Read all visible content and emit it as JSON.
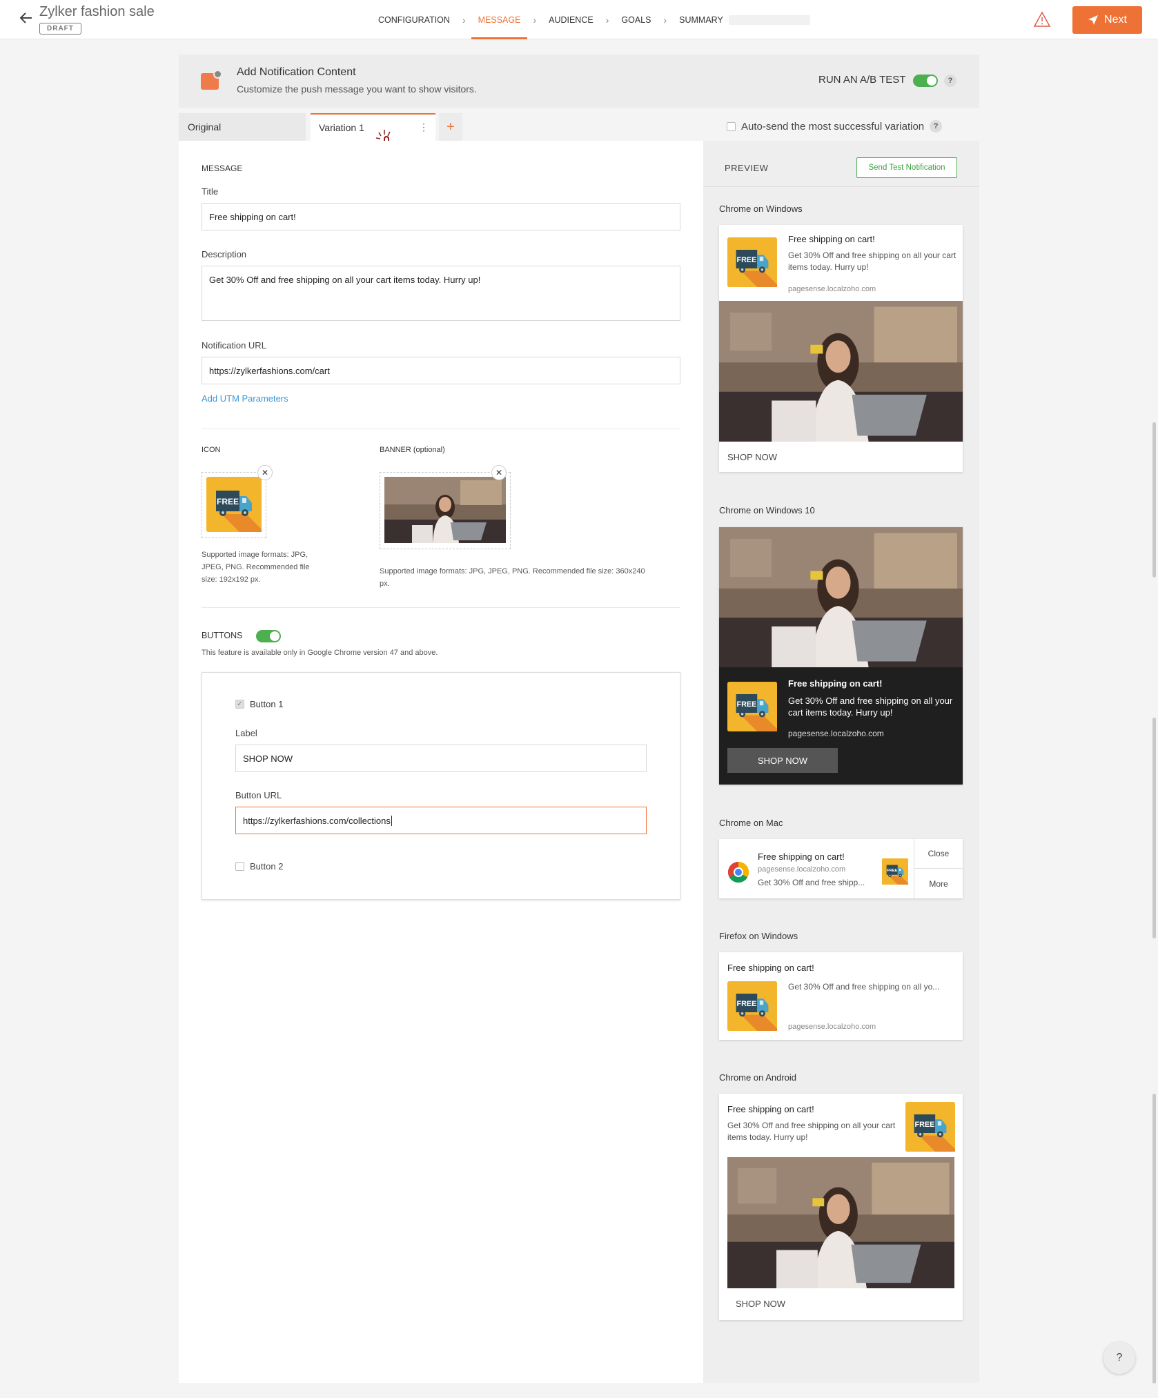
{
  "header": {
    "title": "Zylker fashion sale",
    "status": "DRAFT",
    "steps": [
      "CONFIGURATION",
      "MESSAGE",
      "AUDIENCE",
      "GOALS",
      "SUMMARY"
    ],
    "next_label": "Next"
  },
  "content_header": {
    "title": "Add Notification Content",
    "subtitle": "Customize the push message you want to show visitors.",
    "ab_label": "RUN AN A/B TEST",
    "ab_enabled": true
  },
  "tabs": {
    "original": "Original",
    "variation": "Variation 1",
    "add": "+",
    "autosend_label": "Auto-send the most successful variation"
  },
  "message": {
    "section": "MESSAGE",
    "title_label": "Title",
    "title_value": "Free shipping on cart!",
    "desc_label": "Description",
    "desc_value": "Get 30% Off and free shipping on all your cart items today. Hurry up!",
    "url_label": "Notification URL",
    "url_value": "https://zylkerfashions.com/cart",
    "utm_link": "Add UTM Parameters"
  },
  "media": {
    "icon_label": "ICON",
    "icon_help": "Supported image formats: JPG, JPEG, PNG. Recommended file size: 192x192 px.",
    "banner_label": "BANNER (optional)",
    "banner_help": "Supported image formats: JPG, JPEG, PNG. Recommended file size: 360x240 px.",
    "icon_text": "FREE"
  },
  "buttons": {
    "section": "BUTTONS",
    "enabled": true,
    "note": "This feature is available only in Google Chrome version 47 and above.",
    "button1": "Button 1",
    "label_label": "Label",
    "label_value": "SHOP NOW",
    "url_label": "Button URL",
    "url_value": "https://zylkerfashions.com/collections",
    "button2": "Button 2"
  },
  "preview": {
    "title": "PREVIEW",
    "send_test": "Send Test Notification",
    "domain": "pagesense.localzoho.com",
    "notif_title": "Free shipping on cart!",
    "notif_desc": "Get 30% Off and free shipping on all your cart items today. Hurry up!",
    "notif_desc_trunc_mac": "Get 30% Off and free shipp...",
    "notif_desc_trunc_ff": "Get 30% Off and free shipping on all yo...",
    "button": "SHOP NOW",
    "close": "Close",
    "more": "More",
    "platforms": {
      "chrome_windows": "Chrome on Windows",
      "chrome_windows10": "Chrome on Windows 10",
      "chrome_mac": "Chrome on Mac",
      "firefox_windows": "Firefox on Windows",
      "chrome_android": "Chrome on Android"
    }
  },
  "help": "?",
  "colors": {
    "accent": "#ee7236",
    "toggle": "#4caf50",
    "link": "#3d97d4"
  }
}
